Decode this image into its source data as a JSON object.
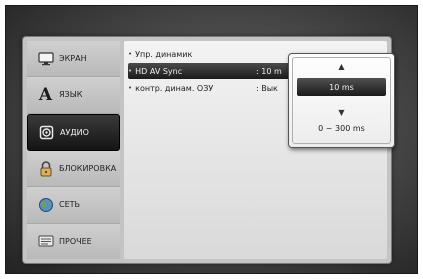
{
  "sidebar": {
    "items": [
      {
        "label": "ЭКРАН",
        "icon": "monitor-icon"
      },
      {
        "label": "ЯЗЫК",
        "icon": "letter-a-icon",
        "glyph": "A"
      },
      {
        "label": "АУДИО",
        "icon": "speaker-icon"
      },
      {
        "label": "БЛОКИРОВКА",
        "icon": "lock-icon"
      },
      {
        "label": "СЕТЬ",
        "icon": "globe-icon"
      },
      {
        "label": "ПРОЧЕЕ",
        "icon": "settings-box-icon"
      }
    ],
    "active_index": 2
  },
  "settings": {
    "rows": [
      {
        "label": "Упр. динамик",
        "value": ""
      },
      {
        "label": "HD AV Sync",
        "value": ": 10 m"
      },
      {
        "label": "контр. динам. ОЗУ",
        "value": ": Вык"
      }
    ],
    "selected_index": 1
  },
  "popup": {
    "up_arrow": "▲",
    "value": "10 ms",
    "down_arrow": "▼",
    "range": "0 ~ 300 ms"
  },
  "colors": {
    "panel": "#c4c4c4",
    "highlight": "#1a1a1a",
    "background": "#4a4a4a"
  }
}
